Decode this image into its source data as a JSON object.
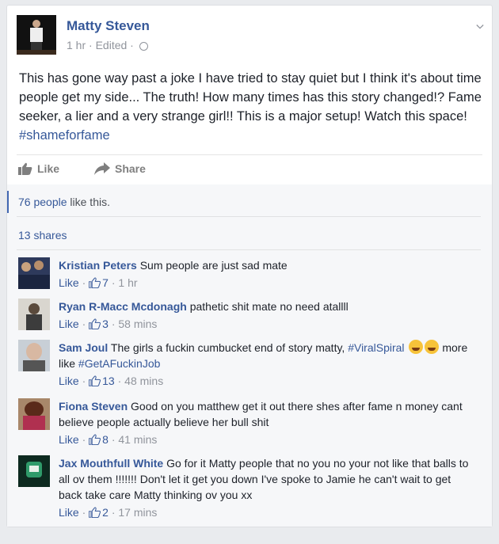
{
  "post": {
    "author": "Matty Steven",
    "time": "1 hr",
    "edited": "Edited",
    "text": "This has gone way past a joke I have tried to stay quiet but I think it's about time people get my side... The truth! How many times has this story changed!? Fame seeker, a lier and a very strange girl!! This is a major setup! Watch this space!",
    "hashtag": "#shameforfame"
  },
  "actions": {
    "like": "Like",
    "share": "Share"
  },
  "ufi": {
    "likes_people": "76 people",
    "likes_suffix": "like this.",
    "shares": "13 shares"
  },
  "comments": [
    {
      "name": "Kristian Peters",
      "text": "Sum people are just sad mate",
      "likes": "7",
      "time": "1 hr",
      "like_label": "Like"
    },
    {
      "name": "Ryan R-Macc Mcdonagh",
      "text": "pathetic shit mate no need atallll",
      "likes": "3",
      "time": "58 mins",
      "like_label": "Like"
    },
    {
      "name": "Sam Joul",
      "text": "The girls a fuckin cumbucket end of story matty,",
      "tag1": "#ViralSpiral",
      "text2": "more like",
      "tag2": "#GetAFuckinJob",
      "likes": "13",
      "time": "48 mins",
      "like_label": "Like"
    },
    {
      "name": "Fiona Steven",
      "text": "Good on you matthew get it out there shes after fame n money cant believe people actually believe her bull shit",
      "likes": "8",
      "time": "41 mins",
      "like_label": "Like"
    },
    {
      "name": "Jax Mouthfull White",
      "text": "Go for it Matty people that no you no your not like that balls to all ov them !!!!!!! Don't let it get you down I've spoke to Jamie he can't wait to get back take care Matty thinking ov you xx",
      "likes": "2",
      "time": "17 mins",
      "like_label": "Like"
    }
  ],
  "colors": {
    "link": "#365899",
    "meta": "#90949c",
    "background": "#e9ebee"
  }
}
